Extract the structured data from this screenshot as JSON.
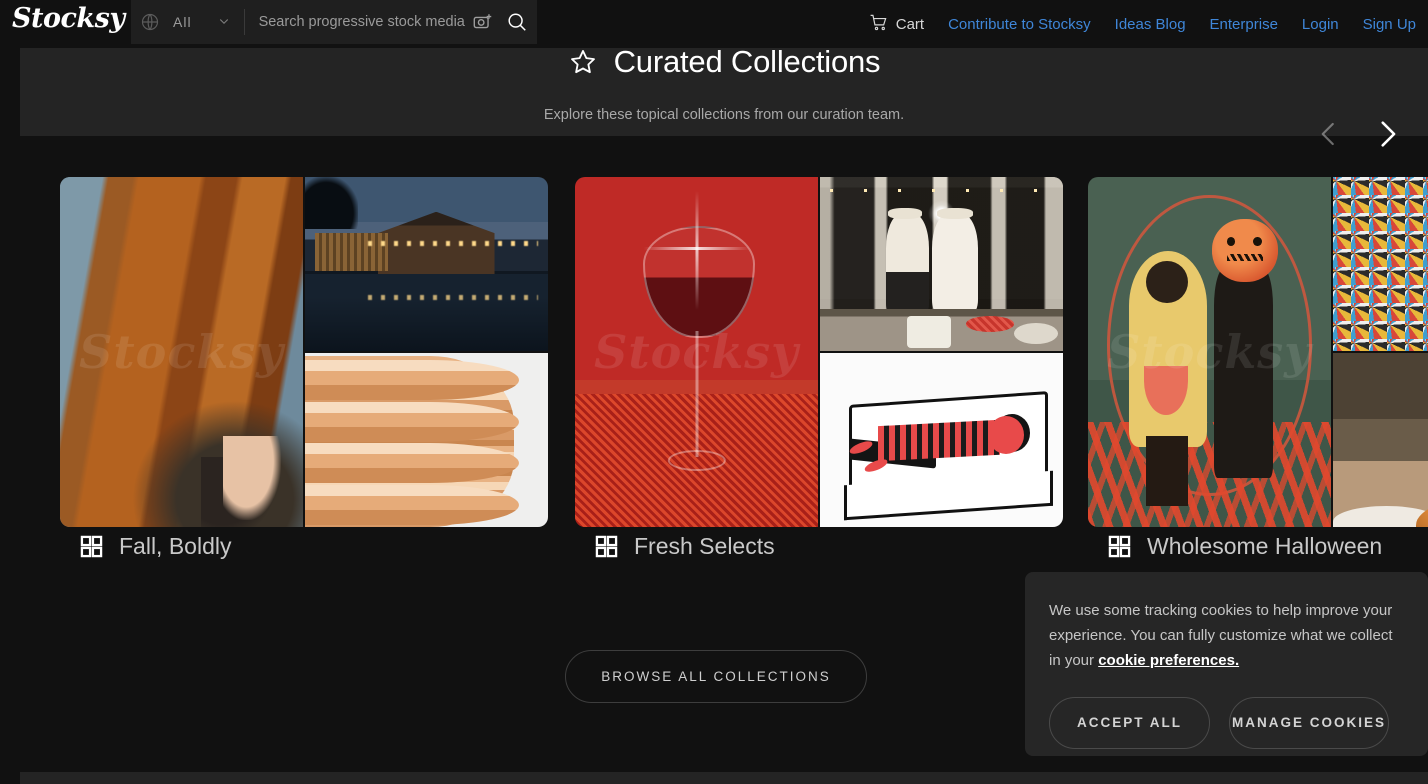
{
  "header": {
    "logo_text": "Stocksy",
    "scope_label": "All",
    "search_placeholder": "Search progressive stock media",
    "search_value": "",
    "cart_label": "Cart",
    "nav_links": [
      {
        "label": "Contribute to Stocksy"
      },
      {
        "label": "Ideas Blog"
      },
      {
        "label": "Enterprise"
      },
      {
        "label": "Login"
      },
      {
        "label": "Sign Up"
      }
    ],
    "link_color": "#3f86d8"
  },
  "panel": {
    "title": "Curated Collections",
    "subtitle": "Explore these topical collections from our curation team.",
    "prev_label": "Previous collections",
    "next_label": "Next collections"
  },
  "collections": [
    {
      "title": "Fall, Boldly",
      "watermark": "Stocksy"
    },
    {
      "title": "Fresh Selects",
      "watermark": "Stocksy"
    },
    {
      "title": "Wholesome Halloween",
      "watermark": "Stocksy"
    }
  ],
  "browse_button": {
    "label": "BROWSE ALL COLLECTIONS"
  },
  "cookie_banner": {
    "text_part1": "We use some tracking cookies to help improve your experience. You can fully customize what we collect in your ",
    "link_label": "cookie preferences.",
    "accept_label": "ACCEPT ALL",
    "manage_label": "MANAGE COOKIES"
  },
  "colors": {
    "page_background": "#111111",
    "panel_background": "#242424",
    "banner_background": "#262626",
    "accent_link": "#3f86d8",
    "text_primary": "#ffffff",
    "text_muted": "#a8a8a8"
  }
}
